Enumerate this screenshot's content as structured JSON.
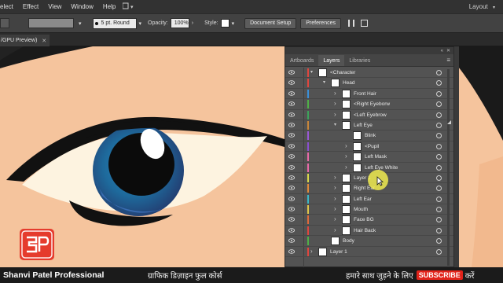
{
  "menubar": {
    "items": [
      "elect",
      "Effect",
      "View",
      "Window",
      "Help"
    ],
    "workspace": "Layout"
  },
  "controlbar": {
    "brush": "5 pt. Round",
    "opacity_label": "Opacity:",
    "opacity_value": "100%",
    "style_label": "Style:",
    "document_setup": "Document Setup",
    "preferences": "Preferences"
  },
  "document_tab": {
    "title": "/GPU Preview)"
  },
  "panel": {
    "tabs": [
      "Artboards",
      "Layers",
      "Libraries"
    ],
    "active_tab": "Layers",
    "layers": [
      {
        "name": "<Character",
        "depth": 0,
        "expanded": true,
        "color": "#e0463e"
      },
      {
        "name": "Head",
        "depth": 1,
        "expanded": true,
        "color": "#e0463e"
      },
      {
        "name": "Front Hair",
        "depth": 2,
        "expanded": false,
        "color": "#3a8fd8"
      },
      {
        "name": "<Right Eyeborw",
        "depth": 2,
        "expanded": false,
        "color": "#4fb047"
      },
      {
        "name": "<Left Eyebrow",
        "depth": 2,
        "expanded": false,
        "color": "#3ca35a"
      },
      {
        "name": "Left Eye",
        "depth": 2,
        "expanded": true,
        "color": "#c8863a"
      },
      {
        "name": "Blink",
        "depth": 3,
        "expanded": null,
        "color": "#9a58d6"
      },
      {
        "name": "<Pupil",
        "depth": 3,
        "expanded": false,
        "color": "#8a4fd0"
      },
      {
        "name": "Left Mask",
        "depth": 3,
        "expanded": false,
        "color": "#e86aa8"
      },
      {
        "name": "Left Eye White",
        "depth": 3,
        "expanded": false,
        "color": "#e86aa8"
      },
      {
        "name": "Layer 1",
        "depth": 2,
        "expanded": false,
        "color": "#d8d84a"
      },
      {
        "name": "Right Ear",
        "depth": 2,
        "expanded": false,
        "color": "#e08a3a"
      },
      {
        "name": "Left Ear",
        "depth": 2,
        "expanded": false,
        "color": "#3ab8c8"
      },
      {
        "name": "Mouth",
        "depth": 2,
        "expanded": false,
        "color": "#e0c64a"
      },
      {
        "name": "Face BG",
        "depth": 2,
        "expanded": false,
        "color": "#e06a3a"
      },
      {
        "name": "Hair Back",
        "depth": 2,
        "expanded": false,
        "color": "#e0463e"
      },
      {
        "name": "Body",
        "depth": 1,
        "expanded": null,
        "color": "#4fb047"
      },
      {
        "name": "Layer 1",
        "depth": 0,
        "expanded": false,
        "color": "#e0463e"
      }
    ]
  },
  "banner": {
    "brand": "Shanvi Patel Professional",
    "course": "ग्राफिक डिज़ाइन फुल कोर्स",
    "join": "हमारे साथ जुड़ने के लिए",
    "subscribe": "SUBSCRIBE",
    "kare": "करें"
  },
  "colors": {
    "skin": "#f5c49d",
    "hair": "#1a1a1a",
    "iris": "#1f6fa0",
    "eye_white": "#fdf3e0",
    "subscribe": "#e2231a"
  }
}
